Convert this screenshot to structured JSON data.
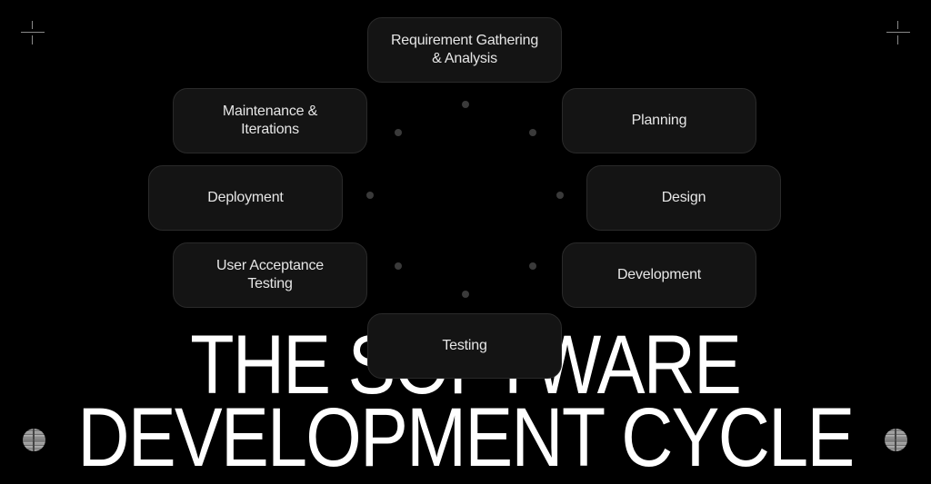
{
  "title": {
    "line1": "THE SOFTWARE",
    "line2": "DEVELOPMENT CYCLE"
  },
  "cycle": {
    "stages": [
      {
        "label": "Requirement Gathering\n& Analysis"
      },
      {
        "label": "Planning"
      },
      {
        "label": "Design"
      },
      {
        "label": "Development"
      },
      {
        "label": "Testing"
      },
      {
        "label": "User Acceptance\nTesting"
      },
      {
        "label": "Deployment"
      },
      {
        "label": "Maintenance &\nIterations"
      }
    ]
  },
  "decorations": {
    "corner_icons": [
      "crosshair-icon",
      "crosshair-icon",
      "globe-icon",
      "globe-icon"
    ]
  },
  "colors": {
    "background": "#000000",
    "card_fill": "#141414",
    "card_border": "#2a2a2a",
    "text": "#ffffff",
    "dot": "#3a3a3a"
  }
}
